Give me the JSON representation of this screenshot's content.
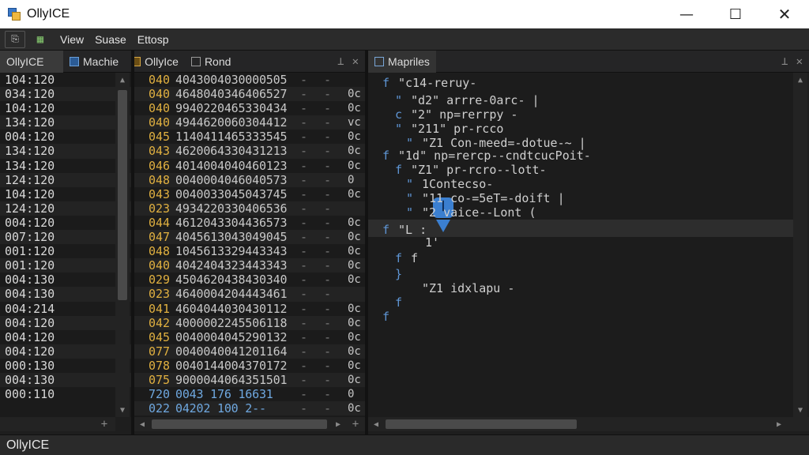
{
  "window": {
    "title": "OllyICE",
    "minimize": "—",
    "maximize": "☐",
    "close": "✕"
  },
  "menu": {
    "items": [
      "View",
      "Suase",
      "Ettosp"
    ]
  },
  "tabs_left": {
    "t1": "OllyICE",
    "t2": "Machie",
    "t3": "OllyIce",
    "t4": "Rond"
  },
  "tabs_right": {
    "t1": "Mapriles"
  },
  "addresses": [
    "104:120",
    "034:120",
    "104:120",
    "134:120",
    "004:120",
    "134:120",
    "134:120",
    "124:120",
    "104:120",
    "124:120",
    "004:120",
    "007:120",
    "001:120",
    "001:120",
    "004:130",
    "004:130",
    "004:214",
    "004:120",
    "004:120",
    "004:120",
    "000:130",
    "004:130",
    "000:110"
  ],
  "hex_rows": [
    {
      "addr": "040",
      "bytes": "4043004030000505",
      "dots": "- -",
      "flag": ""
    },
    {
      "addr": "040",
      "bytes": "4648040346406527",
      "dots": "- -",
      "flag": "0c"
    },
    {
      "addr": "040",
      "bytes": "9940220465330434",
      "dots": "- -",
      "flag": "0c"
    },
    {
      "addr": "040",
      "bytes": "4944620060304412",
      "dots": "- -",
      "flag": "vc"
    },
    {
      "addr": "045",
      "bytes": "1140411465333545",
      "dots": "- -",
      "flag": "0c"
    },
    {
      "addr": "043",
      "bytes": "4620064330431213",
      "dots": "- -",
      "flag": "0c"
    },
    {
      "addr": "046",
      "bytes": "4014004040460123",
      "dots": "- -",
      "flag": "0c"
    },
    {
      "addr": "048",
      "bytes": "0040004046040573",
      "dots": "- -",
      "flag": "0"
    },
    {
      "addr": "043",
      "bytes": "0040033045043745",
      "dots": "- -",
      "flag": "0c"
    },
    {
      "addr": "023",
      "bytes": "4934220330406536",
      "dots": "- -",
      "flag": ""
    },
    {
      "addr": "044",
      "bytes": "4612043304436573",
      "dots": "- -",
      "flag": "0c"
    },
    {
      "addr": "047",
      "bytes": "4045613043049045",
      "dots": "- -",
      "flag": "0c"
    },
    {
      "addr": "048",
      "bytes": "1045613329443343",
      "dots": "- -",
      "flag": "0c"
    },
    {
      "addr": "040",
      "bytes": "4042404323443343",
      "dots": "- -",
      "flag": "0c"
    },
    {
      "addr": "029",
      "bytes": "4504620438430340",
      "dots": "- -",
      "flag": "0c"
    },
    {
      "addr": "023",
      "bytes": "4640004204443461",
      "dots": "- -",
      "flag": ""
    },
    {
      "addr": "041",
      "bytes": "4604044030430112",
      "dots": "- -",
      "flag": "0c"
    },
    {
      "addr": "042",
      "bytes": "4000002245506118",
      "dots": "- -",
      "flag": "0c"
    },
    {
      "addr": "045",
      "bytes": "0040004045290132",
      "dots": "- -",
      "flag": "0c"
    },
    {
      "addr": "077",
      "bytes": "0040040041201164",
      "dots": "- -",
      "flag": "0c"
    },
    {
      "addr": "078",
      "bytes": "0040144004370172",
      "dots": "- -",
      "flag": "0c"
    },
    {
      "addr": "075",
      "bytes": "9000044064351501",
      "dots": "- -",
      "flag": "0c"
    },
    {
      "addr": "720",
      "bytes": "0043 176 16631",
      "dots": "- -",
      "flag": "0"
    },
    {
      "addr": "022",
      "bytes": "04202 100 2--",
      "dots": "- -",
      "flag": "0c"
    }
  ],
  "code_lines": [
    {
      "brace": "f",
      "text": "\"c14-reruy-"
    },
    {
      "brace": "\"",
      "text": "\"d2\" arrre-0arc-  |"
    },
    {
      "brace": "c",
      "text": "\"2\" np=rerrpy -"
    },
    {
      "brace": "\"",
      "text": "\"211\" pr-rcco"
    },
    {
      "brace": "\"",
      "text": "\"Z1 Con-meed=-dotue-~    |"
    },
    {
      "brace": "f",
      "text": "\"1d\" np=rercp--cndtcucPoit-"
    },
    {
      "brace": "f",
      "text": "\"Z1\" pr-rcro--lott-"
    },
    {
      "brace": "\"",
      "text": "1Contecso-"
    },
    {
      "brace": "\"",
      "text": "\"11 co-=5eT=-doift  |"
    },
    {
      "brace": "\"",
      "text": "\"2  vaice--Lont  ("
    },
    {
      "brace": "f",
      "text": "\"L   :"
    },
    {
      "brace": "",
      "text": "1'"
    },
    {
      "brace": "f",
      "text": "f"
    },
    {
      "brace": "}",
      "text": ""
    },
    {
      "brace": "",
      "text": "\"Z1  idxlapu -"
    },
    {
      "brace": "f",
      "text": ""
    },
    {
      "brace": "f",
      "text": ""
    }
  ],
  "status": {
    "text": "OllyICE"
  },
  "colors": {
    "addr_hex": "#e0b040",
    "brace": "#5f96d6",
    "marker": "#3b7fd0"
  }
}
